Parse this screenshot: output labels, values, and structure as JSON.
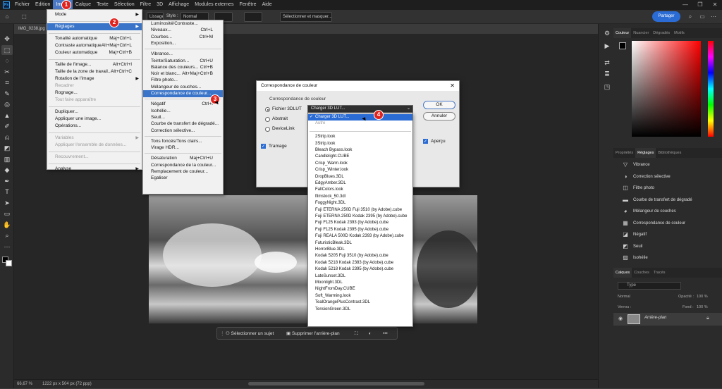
{
  "menubar": {
    "app_icon": "Ps",
    "items": [
      "Fichier",
      "Edition",
      "Image",
      "Calque",
      "Texte",
      "Sélection",
      "Filtre",
      "3D",
      "Affichage",
      "Modules externes",
      "Fenêtre",
      "Aide"
    ]
  },
  "window_controls": {
    "minimize": "—",
    "maximize": "❐",
    "close": "✕"
  },
  "optbar": {
    "lissage": "Lissage",
    "style_label": "Style :",
    "style_value": "Normal",
    "select_mask": "Sélectionner et masquer...",
    "share": "Partager"
  },
  "doc_tab": "IMG_0238.jpg",
  "image_menu": [
    {
      "label": "Mode",
      "sc": "",
      "arrow": true
    },
    {
      "sep": true
    },
    {
      "label": "Réglages",
      "sc": "",
      "arrow": true,
      "hl": true
    },
    {
      "sep": true
    },
    {
      "label": "Tonalité automatique",
      "sc": "Maj+Ctrl+L"
    },
    {
      "label": "Contraste automatique",
      "sc": "Alt+Maj+Ctrl+L"
    },
    {
      "label": "Couleur automatique",
      "sc": "Maj+Ctrl+B"
    },
    {
      "sep": true
    },
    {
      "label": "Taille de l'image...",
      "sc": "Alt+Ctrl+I"
    },
    {
      "label": "Taille de la zone de travail...",
      "sc": "Alt+Ctrl+C"
    },
    {
      "label": "Rotation de l'image",
      "sc": "",
      "arrow": true
    },
    {
      "label": "Recadrer",
      "sc": "",
      "dis": true
    },
    {
      "label": "Rognage...",
      "sc": ""
    },
    {
      "label": "Tout faire apparaître",
      "sc": "",
      "dis": true
    },
    {
      "sep": true
    },
    {
      "label": "Dupliquer...",
      "sc": ""
    },
    {
      "label": "Appliquer une image...",
      "sc": ""
    },
    {
      "label": "Opérations...",
      "sc": ""
    },
    {
      "sep": true
    },
    {
      "label": "Variables",
      "sc": "",
      "arrow": true,
      "dis": true
    },
    {
      "label": "Appliquer l'ensemble de données...",
      "sc": "",
      "dis": true
    },
    {
      "sep": true
    },
    {
      "label": "Recouvrement...",
      "sc": "",
      "dis": true
    },
    {
      "sep": true
    },
    {
      "label": "Analyse",
      "sc": "",
      "arrow": true
    }
  ],
  "reglages_menu": [
    {
      "label": "Luminosité/Contraste...",
      "sc": ""
    },
    {
      "label": "Niveaux...",
      "sc": "Ctrl+L"
    },
    {
      "label": "Courbes...",
      "sc": "Ctrl+M"
    },
    {
      "label": "Exposition...",
      "sc": ""
    },
    {
      "sep": true
    },
    {
      "label": "Vibrance...",
      "sc": ""
    },
    {
      "label": "Teinte/Saturation...",
      "sc": "Ctrl+U"
    },
    {
      "label": "Balance des couleurs...",
      "sc": "Ctrl+B"
    },
    {
      "label": "Noir et blanc...",
      "sc": "Alt+Maj+Ctrl+B"
    },
    {
      "label": "Filtre photo...",
      "sc": ""
    },
    {
      "label": "Mélangeur de couches...",
      "sc": ""
    },
    {
      "label": "Correspondance de couleur...",
      "sc": "",
      "hl": true
    },
    {
      "sep": true
    },
    {
      "label": "Négatif",
      "sc": "Ctrl+I"
    },
    {
      "label": "Isohélie...",
      "sc": ""
    },
    {
      "label": "Seuil...",
      "sc": ""
    },
    {
      "label": "Courbe de transfert de dégradé...",
      "sc": ""
    },
    {
      "label": "Correction sélective...",
      "sc": ""
    },
    {
      "sep": true
    },
    {
      "label": "Tons foncés/Tons clairs...",
      "sc": ""
    },
    {
      "label": "Virage HDR...",
      "sc": ""
    },
    {
      "sep": true
    },
    {
      "label": "Désaturation",
      "sc": "Maj+Ctrl+U"
    },
    {
      "label": "Correspondance de la couleur...",
      "sc": ""
    },
    {
      "label": "Remplacement de couleur...",
      "sc": ""
    },
    {
      "label": "Egaliser",
      "sc": ""
    }
  ],
  "badges": [
    "1",
    "2",
    "3",
    "4"
  ],
  "dialog": {
    "title": "Correspondance de couleur",
    "group": "Correspondance de couleur",
    "radio1": "Fichier 3DLUT",
    "radio2": "Abstrait",
    "radio3": "DeviceLink",
    "selected": "Charger 3D LUT...",
    "dither": "Tramage",
    "preview": "Aperçu",
    "ok": "OK",
    "cancel": "Annuler"
  },
  "dropdown": {
    "items": [
      "Charger 3D LUT...",
      "Autre",
      "",
      "2Strip.look",
      "3Strip.look",
      "Bleach Bypass.look",
      "Candlelight.CUBE",
      "Crisp_Warm.look",
      "Crisp_Winter.look",
      "DropBlues.3DL",
      "EdgyAmber.3DL",
      "FallColors.look",
      "filmstock_50.3dl",
      "FoggyNight.3DL",
      "Fuji ETERNA 250D Fuji 3510 (by Adobe).cube",
      "Fuji ETERNA 250D Kodak 2395 (by Adobe).cube",
      "Fuji F125 Kodak 2393 (by Adobe).cube",
      "Fuji F125 Kodak 2395 (by Adobe).cube",
      "Fuji REALA 500D Kodak 2393 (by Adobe).cube",
      "FuturisticBleak.3DL",
      "HorrorBlue.3DL",
      "Kodak 5205 Fuji 3510 (by Adobe).cube",
      "Kodak 5218 Kodak 2383 (by Adobe).cube",
      "Kodak 5218 Kodak 2395 (by Adobe).cube",
      "LateSunset.3DL",
      "Moonlight.3DL",
      "NightFromDay.CUBE",
      "Soft_Warming.look",
      "TealOrangePlusContrast.3DL",
      "TensionGreen.3DL"
    ]
  },
  "context_bar": {
    "subject": "Sélectionner un sujet",
    "remove_bg": "Supprimer l'arrière-plan",
    "more": "•••"
  },
  "status": {
    "zoom": "66,67 %",
    "size": "1222 px x 504 px (72 ppp)"
  },
  "panels": {
    "color_tabs": [
      "Couleur",
      "Nuancier",
      "Dégradés",
      "Motifs"
    ],
    "adj_tabs": [
      "Propriétés",
      "Réglages",
      "Bibliothèques"
    ],
    "adj_items": [
      "Vibrance",
      "Correction sélective",
      "Filtre photo",
      "Courbe de transfert de dégradé",
      "Mélangeur de couches",
      "Correspondance de couleur",
      "Négatif",
      "Seuil",
      "Isohélie"
    ],
    "layer_tabs": [
      "Calques",
      "Couches",
      "Tracés"
    ],
    "layer_search": "Type",
    "layer_name": "Arrière-plan",
    "opacity_label": "Opacité :",
    "opacity": "100 %",
    "fill_label": "Fond :",
    "fill": "100 %",
    "blend": "Normal",
    "lock": "Verrou :"
  },
  "colors": {
    "accent": "#2b6cd4",
    "badge": "#e2221d",
    "menu_highlight": "#3a74c8"
  }
}
